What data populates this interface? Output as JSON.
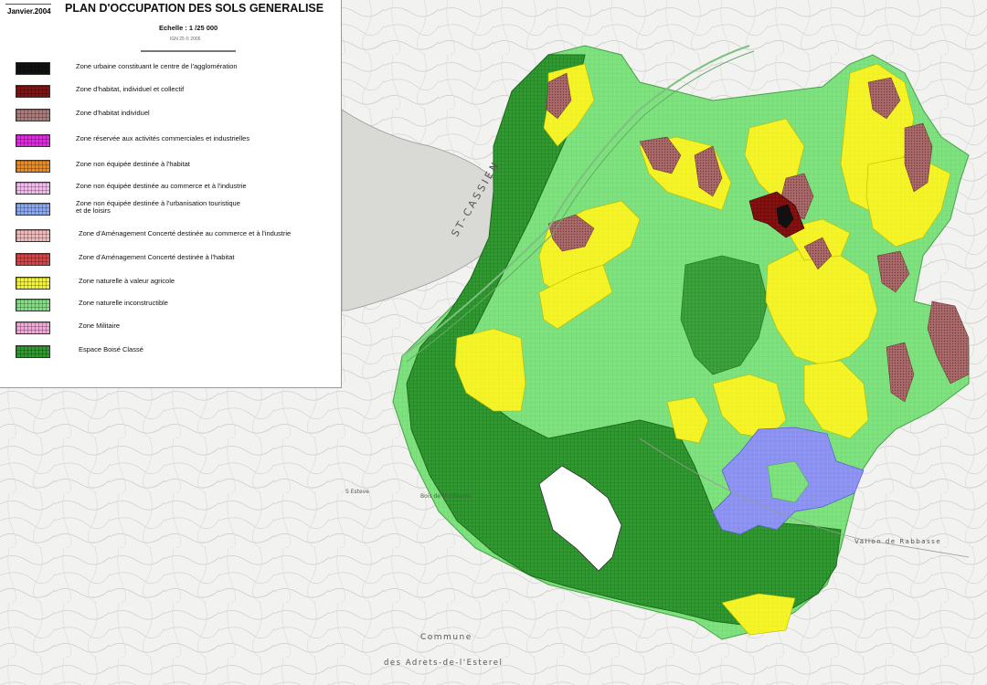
{
  "legend": {
    "date": "Janvier.2004",
    "title": "PLAN D'OCCUPATION DES SOLS GENERALISE",
    "scale": "Echelle  :  1 /25 000",
    "credit": "IGN 25 © 2005",
    "items": [
      {
        "label": "Zone urbaine constituant le centre de l'agglomération",
        "color": "#111111"
      },
      {
        "label": "Zone d'habitat, individuel et collectif",
        "color": "#8b0f0f"
      },
      {
        "label": "Zone d'habitat individuel",
        "color": "#b07a7a"
      },
      {
        "label": "Zone réservée aux activités commerciales et industrielles",
        "color": "#ee22ee"
      },
      {
        "label": "Zone non équipée destinée à l'habitat",
        "color": "#f08a1a"
      },
      {
        "label": "Zone  non équipée destinée au commerce et à l'industrie",
        "color": "#f7b8f0"
      },
      {
        "label": "Zone non équipée destinée à l'urbanisation touristique",
        "label2": "et de loisirs",
        "color": "#8aa8f0"
      },
      {
        "label": "Zone d'Aménagement Concerté destinée au commerce et à l'industrie",
        "color": "#f4b8b8"
      },
      {
        "label": "Zone d'Aménagement Concerté destinée à l'habitat",
        "color": "#e04040"
      },
      {
        "label": "Zone naturelle à valeur agricole",
        "color": "#f4f428"
      },
      {
        "label": "Zone naturelle inconstructible",
        "color": "#7ee27e"
      },
      {
        "label": "Zone Militaire",
        "color": "#f0a8d8"
      },
      {
        "label": "Espace Boisé Classé",
        "color": "#2f9a2f"
      }
    ]
  },
  "map_labels": {
    "lake": "ST-CASSIEN",
    "commune": "Commune",
    "commune2": "des Adrets-de-l'Esterel",
    "bois": "Bois de Montaurox",
    "saint": "S Esteve",
    "siagnole": "Vallon de Rabbasse"
  },
  "colors": {
    "urban": "#111111",
    "habitat_collectif": "#8b0f0f",
    "habitat_individuel": "#a86a6a",
    "agricole": "#f4f428",
    "inconstructible": "#7ee27e",
    "boise": "#2f9a2f",
    "touristique": "#8a90f0"
  }
}
